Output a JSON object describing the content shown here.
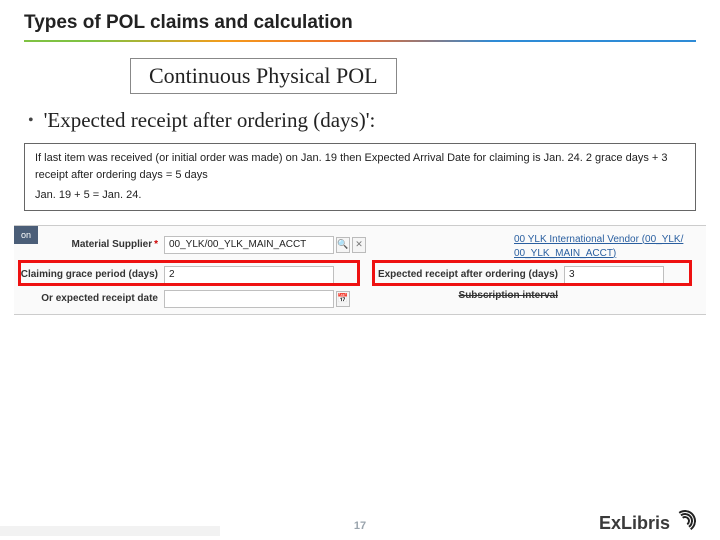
{
  "title": "Types of POL claims and calculation",
  "subtitle": "Continuous Physical POL",
  "bullet": "'Expected receipt after ordering (days)':",
  "box_line1": "If last item was received (or initial order was made) on Jan. 19 then Expected Arrival Date for claiming  is Jan. 24.   2 grace days + 3 receipt after ordering days = 5 days",
  "box_line2": "Jan. 19 + 5 = Jan. 24.",
  "tab": "on",
  "form": {
    "material_supplier_label": "Material Supplier",
    "material_supplier_value": "00_YLK/00_YLK_MAIN_ACCT",
    "vendor_line1": "00 YLK International Vendor (00_YLK/",
    "vendor_line2": "00_YLK_MAIN_ACCT)",
    "claim_label": "Claiming grace period (days)",
    "claim_value": "2",
    "expected_label": "Expected receipt after ordering (days)",
    "expected_value": "3",
    "or_label": "Or expected receipt date",
    "sub_label": "Subscription interval"
  },
  "page": "17",
  "logo": "ExLibris"
}
